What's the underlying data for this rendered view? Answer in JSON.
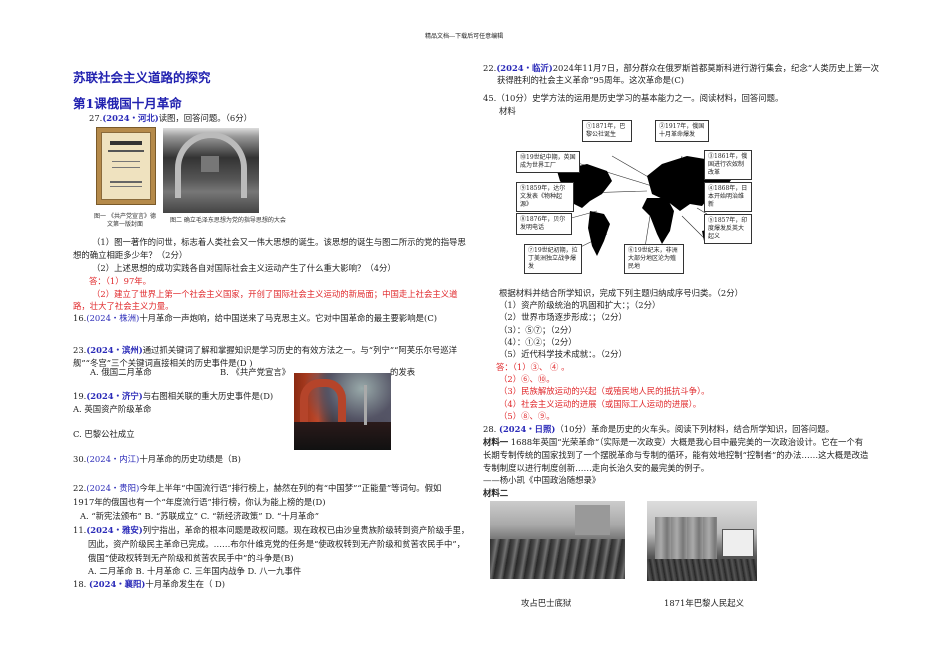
{
  "header": "精品文档---下载后可任意编辑",
  "title": "苏联社会主义道路的探究",
  "lesson": "第1课俄国十月革命",
  "left": {
    "q27": {
      "num": "27.",
      "src": "(2024・河北)",
      "text": "读图，回答问题。（6分）"
    },
    "fig1_caption": "图一 《共产党宣言》德文第一版封面",
    "fig2_caption": "图二 确立毛泽东思想为党的指导思想的大会",
    "q27_1a": "（1）图一著作的问世，标志着人类社会又一伟大思想的诞生。该思想的诞生与图二所示的党的指导思",
    "q27_1b": "想的确立相距多少年？（2分）",
    "q27_2": "（2）上述思想的成功实践各自对国际社会主义运动产生了什么重大影响？（4分）",
    "ans1": "答：（1）97年。",
    "ans2a": "（2）建立了世界上第一个社会主义国家，开创了国际社会主义运动的新局面；中国走上社会主义道",
    "ans2b": "路，壮大了社会主义力量。",
    "q16": {
      "num": "16.",
      "src": "(2024・株洲)",
      "text": "十月革命一声炮响，给中国送来了马克思主义。它对中国革命的最主要影响是(C)"
    },
    "q23": {
      "num": "23.",
      "src": "(2024・滨州)",
      "text": "通过抓关键词了解和掌握知识是学习历史的有效方法之一。与“列宁”“阿芙乐尔号巡洋"
    },
    "q23b": "舰”“冬宫”三个关键词直接相关的历史事件是(D )",
    "q23_opts": {
      "a": "A. 俄国二月革命",
      "b": "B. 《共产党宣言》",
      "c": "的发表"
    },
    "q19": {
      "num": "19.",
      "src": "(2024・济宁)",
      "text": "与右图相关联的重大历史事件是(D)"
    },
    "q19_a": "A. 英国资产阶级革命",
    "q19_c": "C. 巴黎公社成立",
    "q30": {
      "num": "30.",
      "src": "(2024・内江)",
      "text": "十月革命的历史功绩是（B)"
    },
    "q22": {
      "num": "22.",
      "src": "(2024・贵阳)",
      "text": "今年上半年“中国流行语”排行榜上，赫然在列的有“中国梦”“正能量”等词句。假如"
    },
    "q22b": "1917年的俄国也有一个“年度流行语”排行榜，你认为能上榜的是(D)",
    "q22_opts": "A. “新宪法颁布”  B. “苏联成立”  C. “新经济政策”  D. “十月革命”",
    "q11": {
      "num": "11.",
      "src": "(2024・雅安)",
      "text": "列宁指出，革命的根本问题是政权问题。现在政权已由沙皇贵族阶级转到资产阶级手里，"
    },
    "q11b": "因此，资产阶级民主革命已完成。……布尔什维克党的任务是“使政权转到无产阶级和贫苦农民手中”，",
    "q11c": "俄国“使政权转到无产阶级和贫苦农民手中”的斗争是(B)",
    "q11_opts": "A. 二月革命    B. 十月革命         C. 三年国内战争     D. 八一九事件",
    "q18": {
      "num": "18.",
      "src": "(2024・襄阳)",
      "text": "十月革命发生在（ D)"
    }
  },
  "right": {
    "q22": {
      "num": "22.",
      "src": "(2024・临沂)",
      "text": "2024年11月7日，部分群众在俄罗斯首都莫斯科进行游行集会，纪念“人类历史上第一次"
    },
    "q22b": "获得胜利的社会主义革命”95周年。这次革命是(C)",
    "q45": "45.（10分）史学方法的运用是历史学习的基本能力之一。阅读材料，回答问题。",
    "material": "材料",
    "map_labels": [
      "①1871年，巴黎公社诞生",
      "②1917年，俄国十月革命爆发",
      "③1861年，俄国进行农奴制改革",
      "④1868年，日本开始明治维新",
      "⑤1857年，印度爆发反英大起义",
      "⑥19世纪末，非洲大部分地区沦为殖民地",
      "⑦19世纪初期，拉丁美洲独立战争爆发",
      "⑧1876年，贝尔发明电话",
      "⑨1859年，达尔文发表《物种起源》",
      "⑩19世纪中期，英国成为世界工厂"
    ],
    "task": "根据材料并结合所学知识，完成下列主题归纳成序号归类。（2分）",
    "items": [
      "（1）资产阶级统治的巩固和扩大：；（2分）",
      "（2）世界市场逐步形成：；（2分）",
      "（3）：⑤⑦；（2分）",
      "（4）：①②；（2分）",
      "（5）近代科学技术成就：。（2分）"
    ],
    "answers": [
      "答：（1）③、 ④ 。",
      "（2）⑥、⑩。",
      "（3）民族解放运动的兴起（或殖民地人民的抵抗斗争）。",
      "（4）社会主义运动的进展（或国际工人运动的进展）。",
      "（5）⑧、⑨。"
    ],
    "q28": {
      "num": "28.",
      "src": "(2024・日照)",
      "text": "（10分）革命是历史的火车头。阅读下列材料，结合所学知识，回答问题。"
    },
    "m1_label": "材料一",
    "m1a": "1688年英国“光荣革命”（实际是一次政变）大概是我心目中最完美的一次政治设计。它在一个有",
    "m1b": "长期专制传统的国家找到了一个摆脱革命与专制的循环，能有效地控制“控制者”的办法……这大概是改造",
    "m1c": "专制制度以进行制度创新……走向长治久安的最完美的例子。",
    "m1_src": "——杨小凯《中国政治随想录》",
    "m2_label": "材料二",
    "cap1": "攻占巴士底狱",
    "cap2": "1871年巴黎人民起义"
  }
}
